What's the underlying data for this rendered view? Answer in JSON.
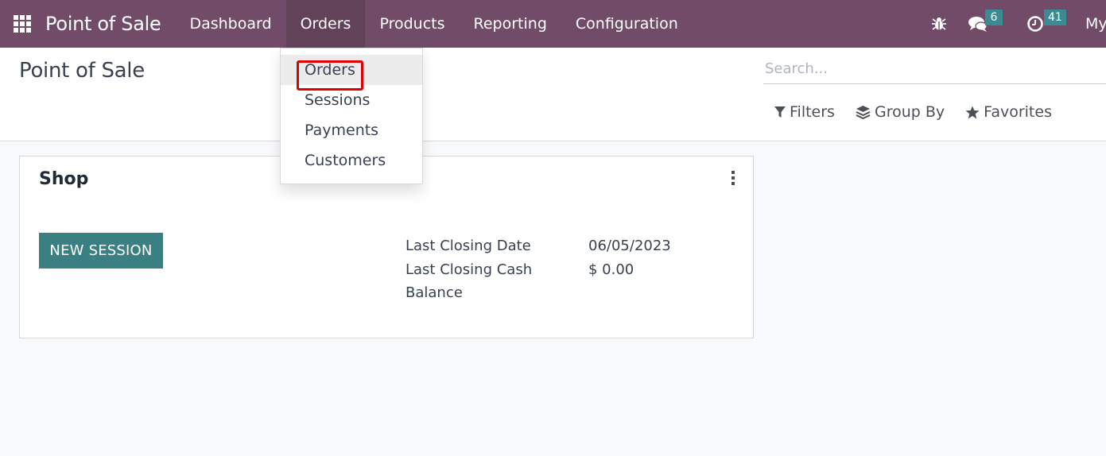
{
  "navbar": {
    "app_icon": "apps-grid-icon",
    "brand": "Point of Sale",
    "menu": [
      {
        "label": "Dashboard",
        "active": false
      },
      {
        "label": "Orders",
        "active": true
      },
      {
        "label": "Products",
        "active": false
      },
      {
        "label": "Reporting",
        "active": false
      },
      {
        "label": "Configuration",
        "active": false
      }
    ],
    "systray": {
      "debug_icon": "bug-icon",
      "messages_icon": "comments-icon",
      "messages_count": "6",
      "activities_icon": "clock-icon",
      "activities_count": "41",
      "user_label": "My"
    }
  },
  "dropdown": {
    "items": [
      {
        "label": "Orders",
        "highlighted": true
      },
      {
        "label": "Sessions"
      },
      {
        "label": "Payments"
      },
      {
        "label": "Customers"
      }
    ]
  },
  "control_panel": {
    "title": "Point of Sale",
    "search_placeholder": "Search...",
    "search_value": "",
    "filters_label": "Filters",
    "group_by_label": "Group By",
    "favorites_label": "Favorites"
  },
  "card": {
    "title": "Shop",
    "new_session_label": "NEW SESSION",
    "fields": [
      {
        "label": "Last Closing Date",
        "value": "06/05/2023"
      },
      {
        "label": "Last Closing Cash",
        "value": "$ 0.00"
      },
      {
        "label": "Balance",
        "value": ""
      }
    ]
  },
  "colors": {
    "navbar": "#714b67",
    "badge": "#3b8b92",
    "primary_button": "#3a7f81",
    "highlight_border": "#e00000"
  }
}
